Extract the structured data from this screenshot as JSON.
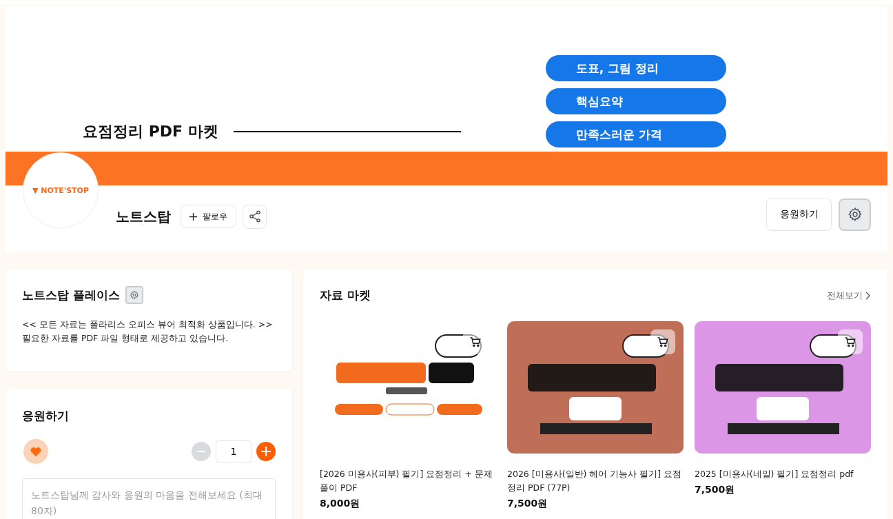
{
  "banner": {
    "title": "요점정리 PDF 마켓",
    "pills": [
      "도표, 그림 정리",
      "핵심요약",
      "만족스러운 가격"
    ]
  },
  "profile": {
    "avatar_text": "▼ NOTE'STOP",
    "name": "노트스탑",
    "follow": "팔로우",
    "support_button": "응원하기"
  },
  "intro": {
    "title": "노트스탑 플레이스",
    "text": "<< 모든 자료는 폴라리스 오피스 뷰어 최적화 상품입니다. >> 필요한 자료를 PDF 파일 형태로 제공하고 있습니다."
  },
  "support": {
    "title": "응원하기",
    "count": "1",
    "placeholder": "노트스탑님께 감사와 응원의 마음을 전해보세요 (최대 80자)"
  },
  "market": {
    "title": "자료 마켓",
    "view_all": "전체보기",
    "products": [
      {
        "title": "[2026 미용사(피부) 필기] 요점정리 + 문제풀이 PDF",
        "price": "8,000원"
      },
      {
        "title": "2026 [미용사(일반) 헤어 기능사 필기] 요점정리 PDF (77P)",
        "price": "7,500원"
      },
      {
        "title": "2025 [미용사(네일) 필기] 요점정리 pdf",
        "price": "7,500원"
      }
    ]
  }
}
